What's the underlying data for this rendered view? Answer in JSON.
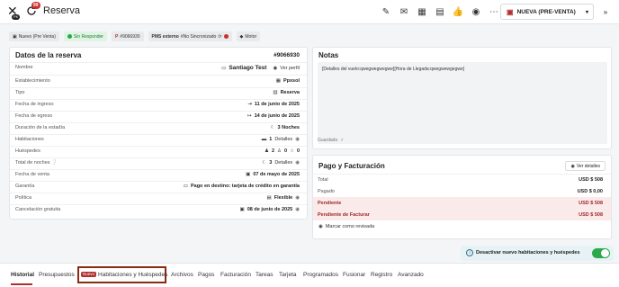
{
  "topbar": {
    "title": "Reserva",
    "close_badge": "PK",
    "sync_badge": "99",
    "icons": [
      "pencil-icon",
      "mail-icon",
      "calculator-icon",
      "document-icon",
      "thumbs-up-icon",
      "coins-icon",
      "more-icon"
    ],
    "status_label": "NUEVA (PRE-VENTA)"
  },
  "tags": [
    {
      "icon": "calendar-icon",
      "label": "Nuevo (Pre Venta)"
    },
    {
      "icon": "green-dot",
      "label": "Sin Responder"
    },
    {
      "icon": "p-icon",
      "label": "#9066930"
    },
    {
      "icon": "pms-icon",
      "label": "PMS externo",
      "extra": "#No Sincronizado"
    },
    {
      "icon": "tag-icon",
      "label": "Motor"
    }
  ],
  "reserva": {
    "title": "Datos de la reserva",
    "id": "#9066930",
    "rows": [
      {
        "label": "Nombre",
        "value": "Santiago Test",
        "extra": "Ver perfil"
      },
      {
        "label": "Establecimiento",
        "value": "Ppxsol"
      },
      {
        "label": "Tipo",
        "value": "Reserva"
      },
      {
        "label": "Fecha de ingreso",
        "value": "11 de junio de 2025"
      },
      {
        "label": "Fecha de egreso",
        "value": "14 de junio de 2025"
      },
      {
        "label": "Duración de la estadía",
        "value": "3 Noches"
      },
      {
        "label": "Habitaciones",
        "value": "1",
        "extra": "Detalles"
      },
      {
        "label": "Huéspedes",
        "value": "2",
        "extra": "0",
        "extra2": "0"
      },
      {
        "label": "Total de noches",
        "value": "3",
        "extra": "Detalles"
      },
      {
        "label": "Fecha de venta",
        "value": "07 de mayo de 2025"
      },
      {
        "label": "Garantía",
        "value": "Pago en destino: tarjeta de crédito en garantía"
      },
      {
        "label": "Política",
        "value": "Flexible"
      },
      {
        "label": "Cancelación gratuita",
        "value": "08 de junio de 2025"
      }
    ]
  },
  "notas": {
    "title": "Notas",
    "text": "[Detalles del vuelo:qwegwegwegwe][Hora de Llegada:qwegwewgegwe]",
    "saved": "Guardado"
  },
  "pago": {
    "title": "Pago y Facturación",
    "details_button": "Ver detalles",
    "rows": [
      {
        "label": "Total",
        "value": "USD $ 508"
      },
      {
        "label": "Pagado",
        "value": "USD $ 0,00"
      },
      {
        "label": "Pendiente",
        "value": "USD $ 508"
      },
      {
        "label": "Pendiente de Facturar",
        "value": "USD $ 508"
      }
    ],
    "mark_reviewed": "Marcar como revisada"
  },
  "toggle": {
    "label": "Desactivar nuevo habitaciones y huéspedes",
    "on": true
  },
  "tabs": [
    {
      "label": "Historial",
      "active": true
    },
    {
      "label": "Presupuestos"
    },
    {
      "label": "Habitaciones y Huéspedes",
      "badge": "Nuevo"
    },
    {
      "label": "Archivos"
    },
    {
      "label": "Pagos"
    },
    {
      "label": "Facturación"
    },
    {
      "label": "Tareas"
    },
    {
      "label": "Tarjeta"
    },
    {
      "label": "Programados"
    },
    {
      "label": "Fusionar"
    },
    {
      "label": "Registro"
    },
    {
      "label": "Avanzado"
    }
  ]
}
